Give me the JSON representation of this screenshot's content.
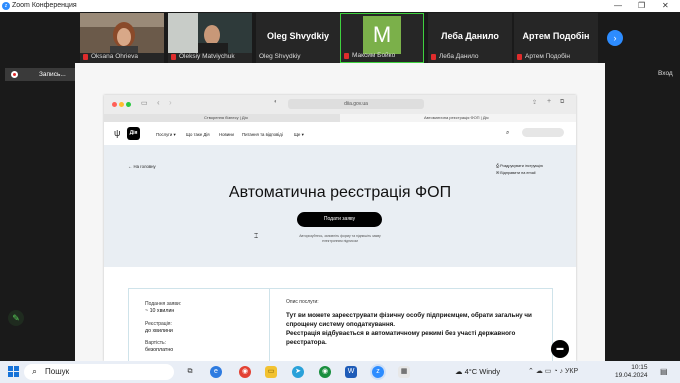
{
  "window": {
    "title": "Zoom Конференция"
  },
  "participants": [
    {
      "name": "Oksana Ohrieva",
      "display": "photo"
    },
    {
      "name": "Oleksiy Matviychuk",
      "display": "photo"
    },
    {
      "name": "Oleg Shvydkiy",
      "display": "Oleg Shvydkiy"
    },
    {
      "name": "Максим Бойко",
      "display": "M"
    },
    {
      "name": "Леба Данило",
      "display": "Леба Данило"
    },
    {
      "name": "Артем Подобін",
      "display": "Артем Подобін"
    }
  ],
  "recording": {
    "label": "Запись..."
  },
  "enter_label": "Вход",
  "browser": {
    "url": "diia.gov.ua",
    "tabs": [
      "Створення бізнесу | Дія",
      "Автоматична реєстрація ФОП | Дія"
    ]
  },
  "site": {
    "logo_text": "Дія",
    "nav": [
      "Послуги ▾",
      "Що таке Дія",
      "Новини",
      "Питання та відповіді",
      "Ще ▾"
    ],
    "back": "На головну",
    "instructions": [
      "Роздрукувати інструкцію",
      "Відправити на email"
    ],
    "title": "Автоматична реєстрація ФОП",
    "submit": "Подати заяву",
    "note": "Авторизуйтесь, заповніть форму та підпишіть заяву електронним підписом",
    "card": {
      "duration_label": "Подання заяви:",
      "duration_value": "~ 10 хвилин",
      "registration_label": "Реєстрація:",
      "registration_value": "до хвилини",
      "cost_label": "Вартість:",
      "cost_value": "безоплатно",
      "desc_label": "Опис послуги:",
      "desc_1": "Тут ви можете зареєструвати фізичну особу підприємцем, обрати загальну чи спрощену систему оподаткування.",
      "desc_2": "Реєстрація відбувається в автоматичному режимі без участі державного реєстратора."
    }
  },
  "taskbar": {
    "search": "Пошук",
    "weather": "4°C  Windy",
    "lang": "УКР",
    "time": "10:15",
    "date": "19.04.2024"
  }
}
